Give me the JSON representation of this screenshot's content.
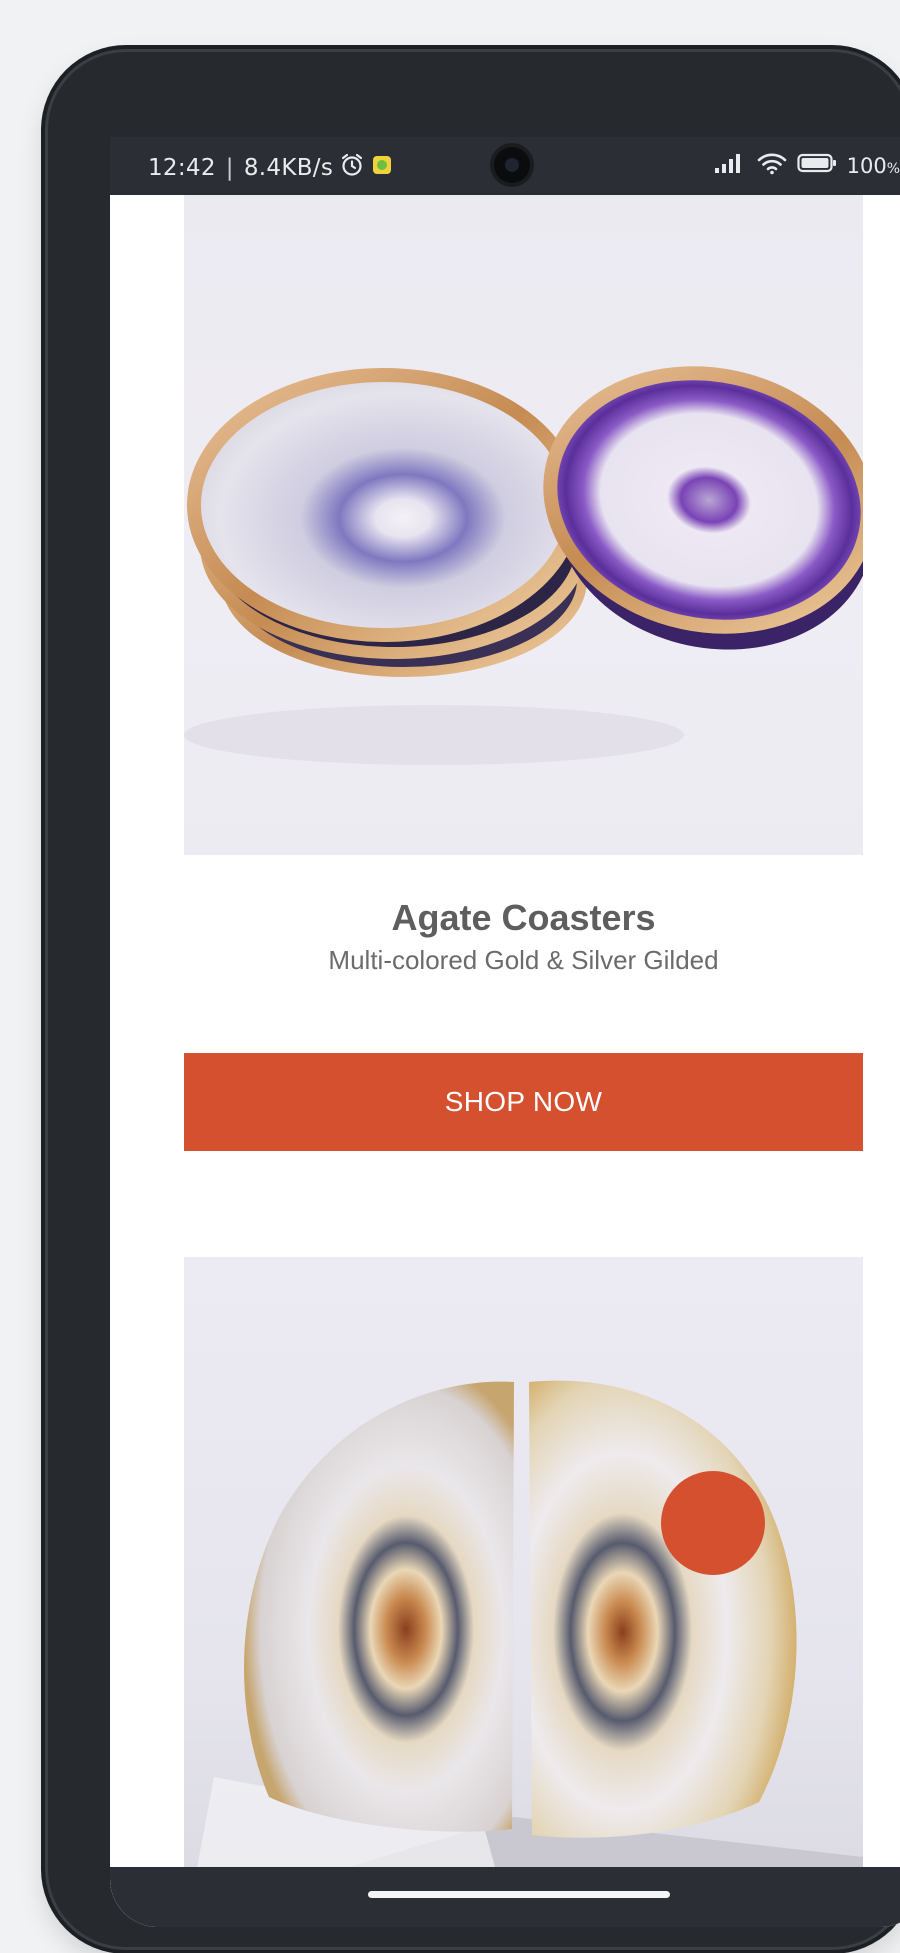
{
  "status_bar": {
    "time": "12:42",
    "separator": "|",
    "network_speed": "8.4KB/s",
    "battery_percent": "100",
    "battery_unit": "%",
    "icons": [
      "alarm-icon",
      "app-notification-icon",
      "signal-icon",
      "wifi-icon",
      "battery-icon"
    ]
  },
  "product_1": {
    "image": "agate-coasters-photo",
    "title": "Agate Coasters",
    "subtitle": "Multi-colored Gold & Silver Gilded",
    "cta_label": "SHOP NOW"
  },
  "product_2": {
    "image": "agate-bookends-photo"
  },
  "colors": {
    "accent": "#d5502f",
    "title_text": "#5e5e5e",
    "subtitle_text": "#6b6b6b",
    "phone_frame": "#262a2f",
    "status_bar_bg": "#2b2f35"
  }
}
